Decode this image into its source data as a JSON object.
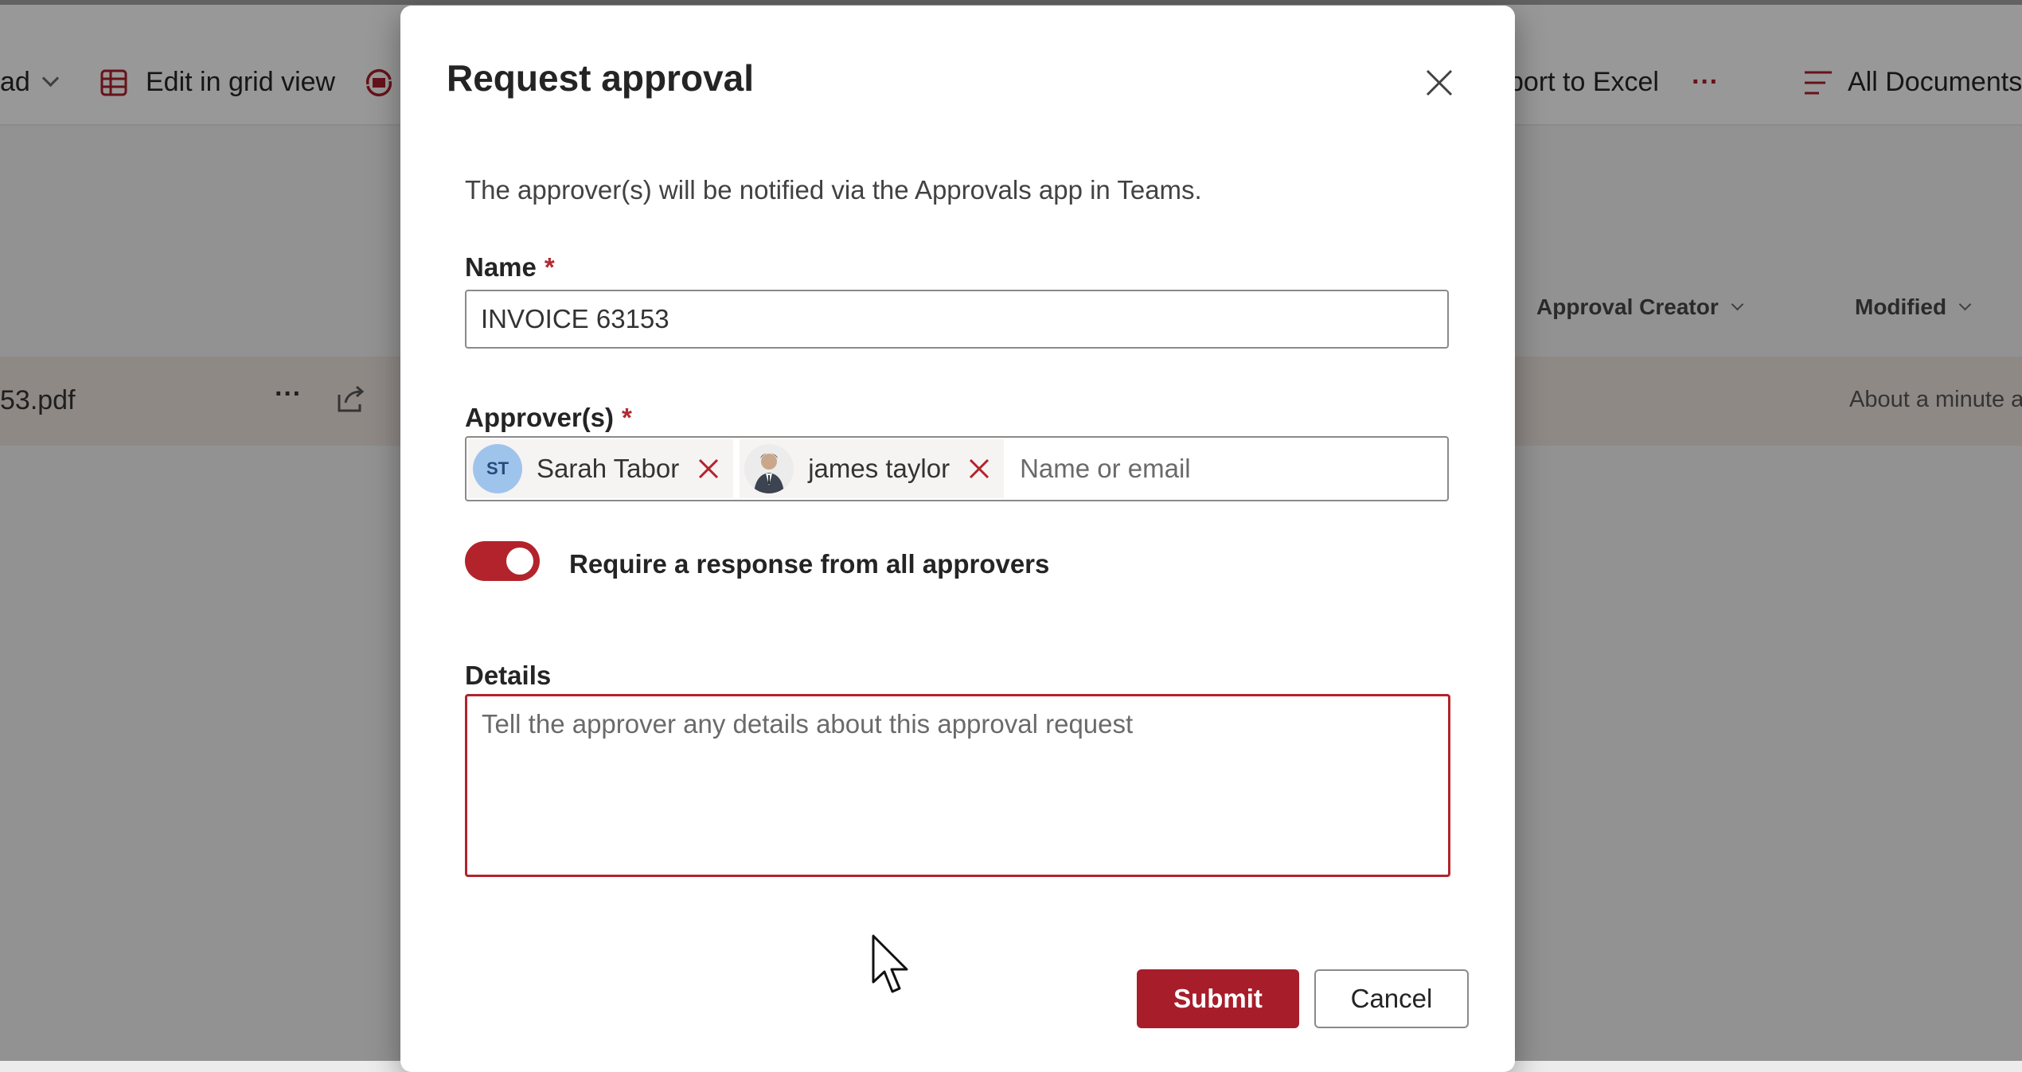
{
  "background": {
    "toolbar": {
      "upload_partial": "ad",
      "edit_grid_label": "Edit in grid view",
      "export_partial": "port to Excel",
      "more_label": "···",
      "view_label": "All Documents"
    },
    "columns": {
      "approval_creator": "Approval Creator",
      "modified": "Modified"
    },
    "row": {
      "file_partial": "53.pdf",
      "more_label": "···",
      "modified_partial": "About a minute a"
    }
  },
  "dialog": {
    "title": "Request approval",
    "description": "The approver(s) will be notified via the Approvals app in Teams.",
    "name_label": "Name",
    "required_marker": "*",
    "name_value": "INVOICE  63153",
    "approvers_label": "Approver(s)",
    "approvers": [
      {
        "initials": "ST",
        "name": "Sarah Tabor"
      },
      {
        "initials": "",
        "name": "james taylor"
      }
    ],
    "approver_placeholder": "Name or email",
    "toggle_label": "Require a response from all approvers",
    "toggle_on": true,
    "details_label": "Details",
    "details_placeholder": "Tell the approver any details about this approval request",
    "submit_label": "Submit",
    "cancel_label": "Cancel"
  },
  "colors": {
    "accent": "#a71d2a",
    "toggle": "#b3232c",
    "avatar_st": "#9fc4ec"
  }
}
